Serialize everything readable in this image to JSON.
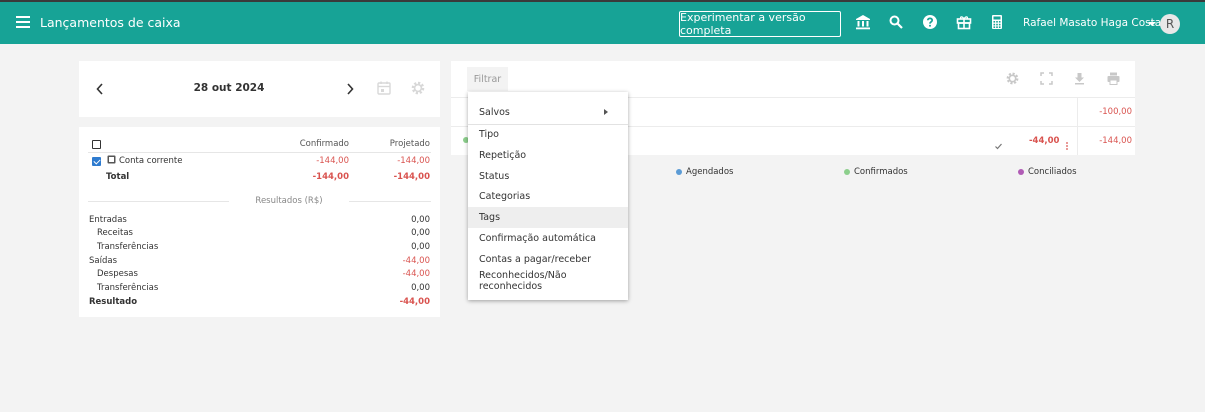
{
  "header": {
    "title": "Lançamentos de caixa",
    "cta_label": "Experimentar a versão completa",
    "icons": [
      "bank-icon",
      "search-icon",
      "help-icon",
      "gift-icon",
      "calculator-icon"
    ],
    "user_name": "Rafael Masato Haga Costa",
    "avatar_letter": "R",
    "accent_color": "#17a396"
  },
  "date_panel": {
    "date": "28 out 2024"
  },
  "summary": {
    "col_confirmed": "Confirmado",
    "col_projected": "Projetado",
    "account": {
      "name": "Conta corrente",
      "confirmed": "-144,00",
      "projected": "-144,00"
    },
    "total": {
      "label": "Total",
      "confirmed": "-144,00",
      "projected": "-144,00"
    },
    "results_title": "Resultados (R$)",
    "results": [
      {
        "label": "Entradas",
        "value": "0,00"
      },
      {
        "label": "Receitas",
        "value": "0,00"
      },
      {
        "label": "Transferências",
        "value": "0,00"
      },
      {
        "label": "Saídas",
        "value": "-44,00"
      },
      {
        "label": "Despesas",
        "value": "-44,00"
      },
      {
        "label": "Transferências",
        "value": "0,00"
      },
      {
        "label": "Resultado",
        "value": "-44,00"
      }
    ]
  },
  "main": {
    "filter_label": "Filtrar",
    "toolbar_icons": [
      "settings-icon",
      "fullscreen-icon",
      "download-icon",
      "print-icon"
    ],
    "rows": [
      {
        "balance": "-100,00"
      },
      {
        "amount": "-44,00",
        "balance": "-144,00"
      }
    ],
    "legend": [
      {
        "label": "Agendados",
        "color": "#5b9bd5"
      },
      {
        "label": "Confirmados",
        "color": "#8ccf8c"
      },
      {
        "label": "Conciliados",
        "color": "#b05bb5"
      }
    ]
  },
  "filter_menu": {
    "items": [
      {
        "label": "Salvos"
      },
      {
        "label": "Tipo"
      },
      {
        "label": "Repetição"
      },
      {
        "label": "Status"
      },
      {
        "label": "Categorias"
      },
      {
        "label": "Tags"
      },
      {
        "label": "Confirmação automática"
      },
      {
        "label": "Contas a pagar/receber"
      },
      {
        "label": "Reconhecidos/Não reconhecidos"
      }
    ]
  }
}
